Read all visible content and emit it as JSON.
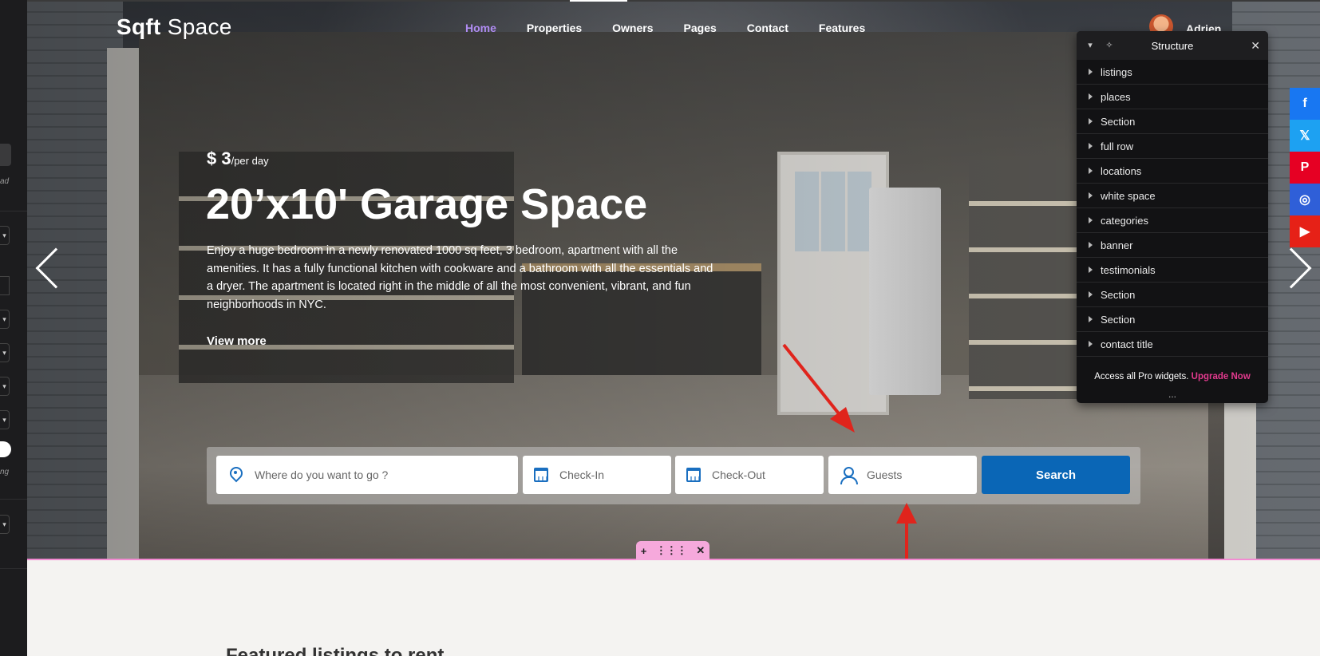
{
  "site": {
    "logo_bold": "Sqft",
    "logo_light": "Space",
    "nav": [
      "Home",
      "Properties",
      "Owners",
      "Pages",
      "Contact",
      "Features"
    ],
    "user_name": "Adrien"
  },
  "hero": {
    "price": "$ 3",
    "price_unit": "/per day",
    "title": "20’x10' Garage Space",
    "description": "Enjoy a huge bedroom in a newly renovated 1000 sq feet, 3 bedroom, apartment with all the amenities. It has a fully functional kitchen with cookware and a bathroom with all the essentials and a dryer. The apartment is located right in the middle of all the most convenient, vibrant, and fun neighborhoods in NYC.",
    "view_more": "View more"
  },
  "search": {
    "location_placeholder": "Where do you want to go ?",
    "checkin_placeholder": "Check-In",
    "checkout_placeholder": "Check-Out",
    "guests_placeholder": "Guests",
    "button_label": "Search"
  },
  "section_toolbar": {
    "add": "+",
    "move": "⋮⋮⋮",
    "remove": "✕"
  },
  "featured_heading": "Featured listings to rent",
  "social": [
    {
      "name": "facebook-icon",
      "glyph": "f",
      "color": "#1877f2"
    },
    {
      "name": "x-icon",
      "glyph": "𝕏",
      "color": "#1da1f2"
    },
    {
      "name": "pinterest-icon",
      "glyph": "P",
      "color": "#e60023"
    },
    {
      "name": "instagram-icon",
      "glyph": "◎",
      "color": "#2f5fd8"
    },
    {
      "name": "youtube-icon",
      "glyph": "▶",
      "color": "#e62117"
    }
  ],
  "structure_panel": {
    "title": "Structure",
    "close": "✕",
    "items": [
      "listings",
      "places",
      "Section",
      "full row",
      "locations",
      "white space",
      "categories",
      "banner",
      "testimonials",
      "Section",
      "Section",
      "contact title"
    ],
    "footer_text": "Access all Pro widgets.",
    "footer_link": "Upgrade Now",
    "dots": "..."
  },
  "editor": {
    "collapse_glyph": "‹",
    "caret_glyph": "▾",
    "label_fragments": [
      "ad",
      "ng"
    ]
  },
  "colors": {
    "nav_active": "#b08cf2",
    "search_button": "#0a66b6",
    "annotation_arrow": "#e0241c",
    "section_outline": "#f28bd2",
    "upgrade_link": "#e23a8e"
  }
}
